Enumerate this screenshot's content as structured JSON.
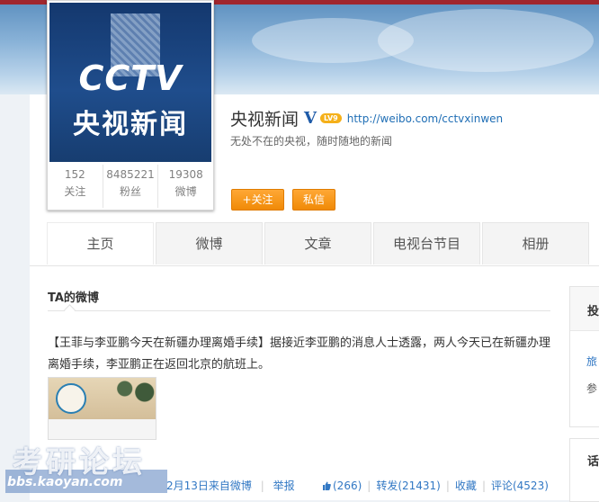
{
  "profile": {
    "name": "央视新闻",
    "verified_mark": "V",
    "level_badge": "LV9",
    "home_url": "http://weibo.com/cctvxinwen",
    "bio": "无处不在的央视，随时随地的新闻",
    "avatar_logo": "CCTV",
    "avatar_sub": "央视新闻",
    "stats": [
      {
        "value": "152",
        "label": "关注"
      },
      {
        "value": "8485221",
        "label": "粉丝"
      },
      {
        "value": "19308",
        "label": "微博"
      }
    ],
    "follow_label": "+关注",
    "message_label": "私信"
  },
  "tabs": [
    {
      "label": "主页",
      "active": true
    },
    {
      "label": "微博",
      "active": false
    },
    {
      "label": "文章",
      "active": false
    },
    {
      "label": "电视台节目",
      "active": false
    },
    {
      "label": "相册",
      "active": false
    }
  ],
  "feed": {
    "section_title": "TA的微博",
    "post": {
      "text": "【王菲与李亚鹏今天在新疆办理离婚手续】据接近李亚鹏的消息人士透露，两人今天已在新疆办理离婚手续，李亚鹏正在返回北京的航班上。",
      "meta_left": "2月13日来自微博",
      "report_label": "举报",
      "likes": "(266)",
      "repost_label": "转发(21431)",
      "favorite_label": "收藏",
      "comment_label": "评论(4523)"
    }
  },
  "sidebar": {
    "box1_title": "投",
    "box1_link": "旅",
    "box1_text": "参",
    "box2_title": "话"
  },
  "watermark": {
    "title": "考研论坛",
    "url": "bbs.kaoyan.com"
  },
  "colors": {
    "brand_orange": "#f08a07",
    "link_blue": "#3278c4",
    "header_red": "#a0262d"
  }
}
